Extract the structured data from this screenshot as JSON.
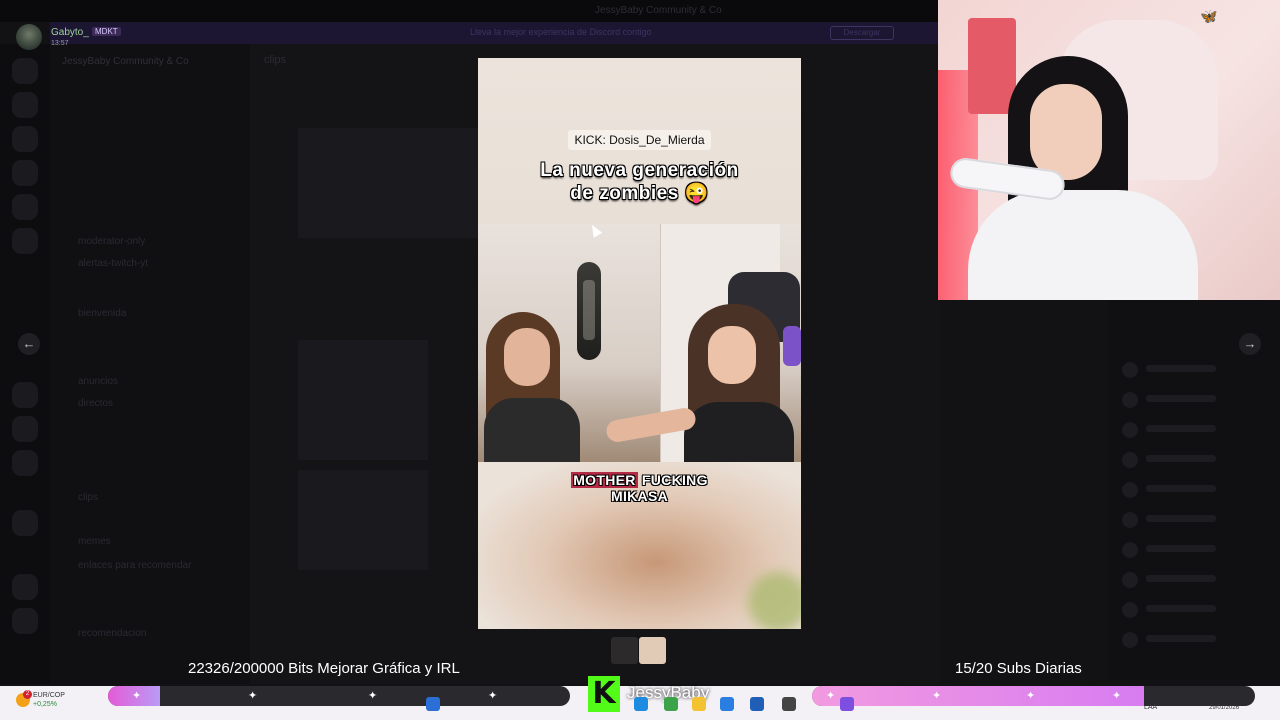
{
  "window": {
    "title": "JessyBaby Community & Co"
  },
  "notice": {
    "text": "Lleva la mejor experiencia de Discord contigo",
    "button": "Descargar"
  },
  "server": {
    "name": "JessyBaby Community & Co"
  },
  "channel": {
    "name": "clips"
  },
  "channels": [
    {
      "label": "moderator-only"
    },
    {
      "label": "alertas-twitch-yt"
    },
    {
      "label": "bienvenida"
    },
    {
      "label": "anuncios"
    },
    {
      "label": "directos"
    },
    {
      "label": "clips"
    },
    {
      "label": "memes"
    },
    {
      "label": "enlaces para recomendar"
    },
    {
      "label": "recomendacion"
    }
  ],
  "user": {
    "name": "Gabyto_",
    "badge": "MDKT",
    "time": "13:57"
  },
  "nav": {
    "prev": "←",
    "next": "→"
  },
  "video": {
    "source_tag": "KICK: Dosis_De_Mierda",
    "caption_line1": "La nueva generación",
    "caption_line2": "de zombies 😜",
    "subtitle_highlight": "MOTHER",
    "subtitle_rest": "FUCKING MIKASA"
  },
  "overlay": {
    "bits_text": "22326/200000 Bits Mejorar Gráfica y IRL",
    "bits_progress": 0.112,
    "subs_text": "15/20 Subs Diarias",
    "subs_progress": 0.75,
    "streamer_name": "JessyBaby",
    "kick_logo": "K"
  },
  "taskbar": {
    "forex_pair": "EUR/COP",
    "forex_change": "+0,25%",
    "notification_count": "2",
    "language": "LAA",
    "date": "29/01/2026"
  },
  "colors": {
    "kick_green": "#53fc18",
    "bits_bar": "#e45bd6",
    "subs_bar": "#f29ae0",
    "subtitle_highlight": "#b52b45"
  }
}
